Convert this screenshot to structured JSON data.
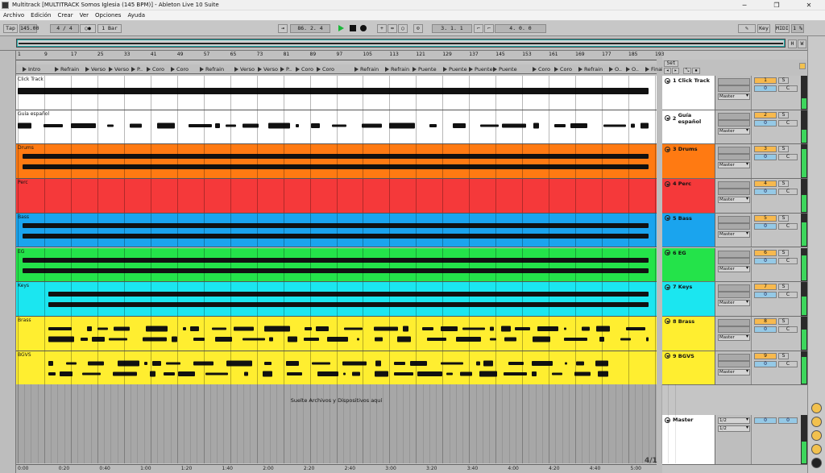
{
  "window": {
    "title": "Multitrack  [MULTITRACK Somos Iglesia (145 BPM)] - Ableton Live 10 Suite",
    "controls": [
      "─",
      "❐",
      "✕"
    ]
  },
  "menu": [
    "Archivo",
    "Edición",
    "Crear",
    "Ver",
    "Opciones",
    "Ayuda"
  ],
  "transport": {
    "tap": "Tap",
    "tempo": "145.00",
    "signature": "4 / 4",
    "metronome": "○●",
    "quantize": "1 Bar",
    "position": "86.  2.  4",
    "loop_start": "3.  1.  1",
    "loop_length": "4.  0.  0",
    "key": "Key",
    "midi": "MIDI",
    "cpu": "1 %",
    "status_color_play": "#1bb73a"
  },
  "overview_buttons": [
    "H",
    "W"
  ],
  "ruler_bars": [
    "1",
    "9",
    "17",
    "25",
    "33",
    "41",
    "49",
    "57",
    "65",
    "73",
    "81",
    "89",
    "97",
    "105",
    "113",
    "121",
    "129",
    "137",
    "145",
    "153",
    "161",
    "169",
    "177",
    "185",
    "193"
  ],
  "locators": [
    "Intro",
    "Refrain",
    "Verso",
    "Verso",
    "P..",
    "Coro",
    "Coro",
    "Refrain",
    "Verso",
    "Verso",
    "P..",
    "Coro",
    "Coro",
    "Refrain",
    "Refrain",
    "Puente",
    "Puente",
    "Puente",
    "Puente",
    "Coro",
    "Coro",
    "Refrain",
    "O..",
    "O..",
    "Final"
  ],
  "set_button": "Set",
  "tracks": [
    {
      "num": "1",
      "name": "Click Track",
      "color": "#ffffff",
      "route": "Master",
      "volume": "0",
      "solo": "S",
      "pan": "C",
      "meter": 0.3
    },
    {
      "num": "2",
      "name": "Guía español",
      "color": "#ffffff",
      "route": "Master",
      "volume": "0",
      "solo": "S",
      "pan": "C",
      "meter": 0.4
    },
    {
      "num": "3",
      "name": "Drums",
      "color": "#ff7a12",
      "route": "Master",
      "volume": "0",
      "solo": "S",
      "pan": "C",
      "meter": 0.85
    },
    {
      "num": "4",
      "name": "Perc",
      "color": "#f5393a",
      "route": "Master",
      "volume": "0",
      "solo": "S",
      "pan": "C",
      "meter": 0.5
    },
    {
      "num": "5",
      "name": "Bass",
      "color": "#1aa4ee",
      "route": "Master",
      "volume": "0",
      "solo": "S",
      "pan": "C",
      "meter": 0.7
    },
    {
      "num": "6",
      "name": "EG",
      "color": "#24e34a",
      "route": "Master",
      "volume": "0",
      "solo": "S",
      "pan": "C",
      "meter": 0.75
    },
    {
      "num": "7",
      "name": "Keys",
      "color": "#1be6f0",
      "route": "Master",
      "volume": "0",
      "solo": "S",
      "pan": "C",
      "meter": 0.55
    },
    {
      "num": "8",
      "name": "Brass",
      "color": "#ffee30",
      "route": "Master",
      "volume": "0",
      "solo": "S",
      "pan": "C",
      "meter": 0.6
    },
    {
      "num": "9",
      "name": "BGVS",
      "color": "#ffee30",
      "route": "Master",
      "volume": "0",
      "solo": "S",
      "pan": "C",
      "meter": 0.8
    }
  ],
  "master": {
    "name": "Master",
    "route1": "1/2",
    "route2": "1/2",
    "volume": "0",
    "cue": "0"
  },
  "drop_hint": "Suelte Archivos y Dispositivos aquí",
  "time_marks": [
    "0:00",
    "0:20",
    "0:40",
    "1:00",
    "1:20",
    "1:40",
    "2:00",
    "2:20",
    "2:40",
    "3:00",
    "3:20",
    "3:40",
    "4:00",
    "4:20",
    "4:40",
    "5:00"
  ],
  "meter_label": "4/1"
}
